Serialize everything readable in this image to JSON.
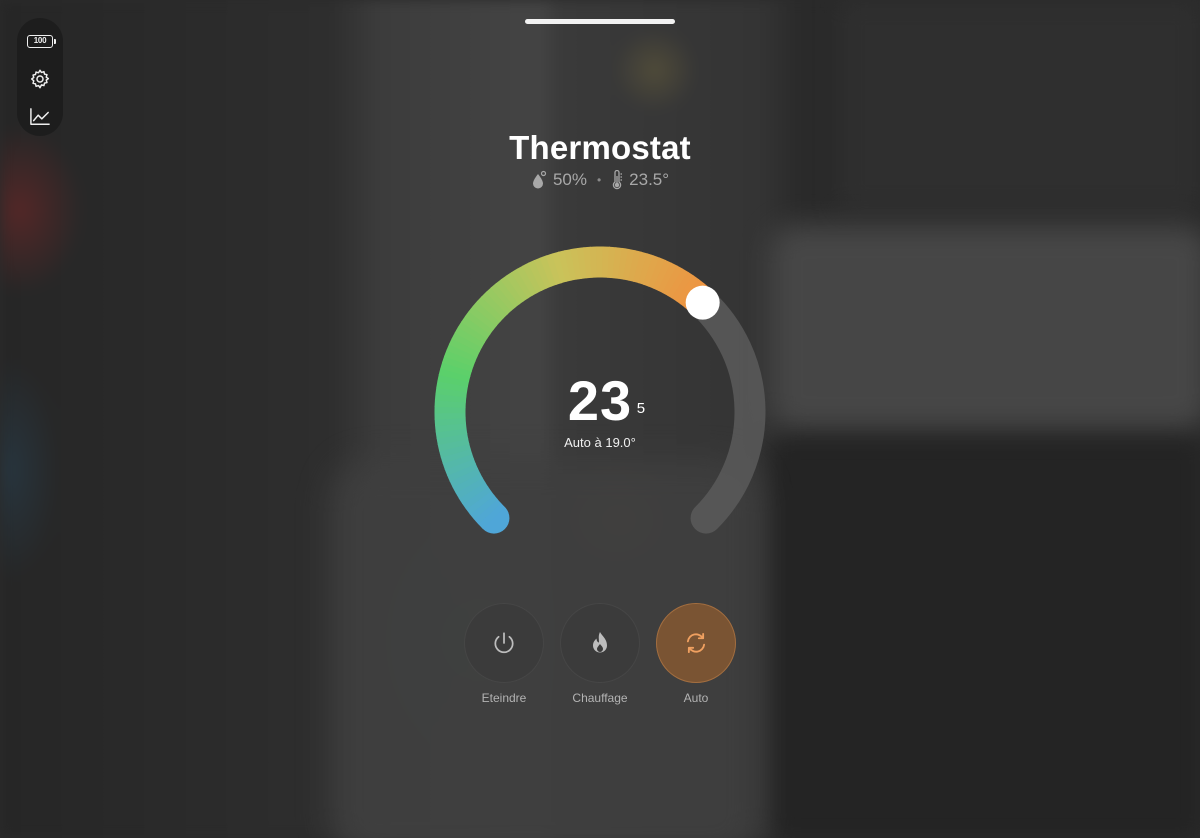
{
  "toolbar": {
    "battery_level": "100",
    "items": [
      {
        "icon": "battery-icon"
      },
      {
        "icon": "gear-icon"
      },
      {
        "icon": "chart-icon"
      }
    ]
  },
  "card": {
    "title": "Thermostat",
    "humidity": "50%",
    "current_temperature": "23.5°"
  },
  "dial": {
    "target_whole": "23",
    "target_decimal": "5",
    "mode_text": "Auto à 19.0°",
    "level_fraction": 0.66,
    "gradient_colors": [
      "#4fa6d8",
      "#5bd06a",
      "#c9c35a",
      "#f0913f"
    ],
    "track_color": "#5a5a5a"
  },
  "modes": [
    {
      "id": "off",
      "label": "Eteindre",
      "icon": "power-icon",
      "active": false
    },
    {
      "id": "heat",
      "label": "Chauffage",
      "icon": "flame-icon",
      "active": false
    },
    {
      "id": "auto",
      "label": "Auto",
      "icon": "auto-cycle-icon",
      "active": true,
      "accent": "#f0a060"
    }
  ]
}
